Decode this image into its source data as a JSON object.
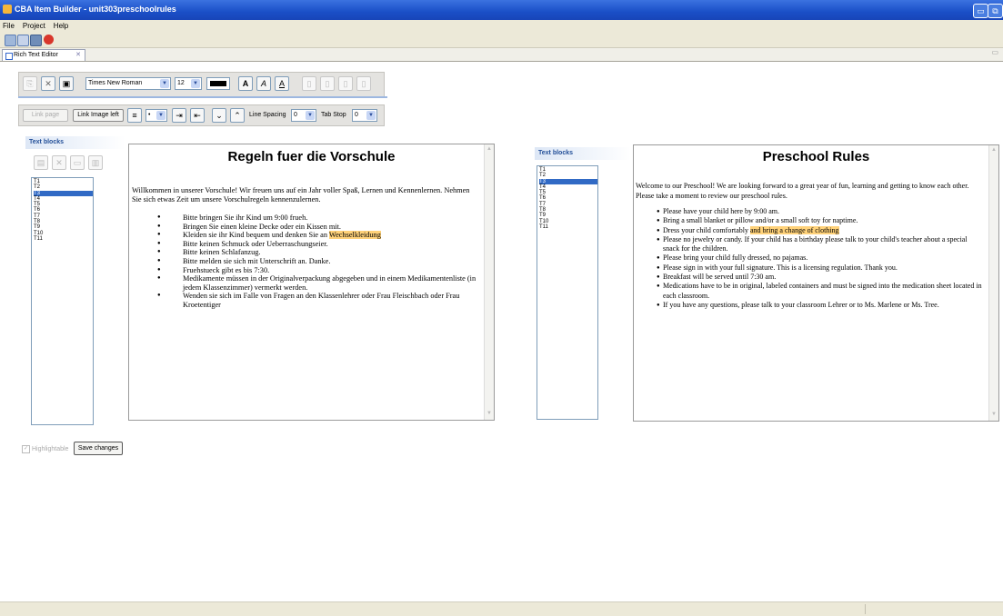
{
  "window": {
    "title": "CBA Item Builder - unit303preschoolrules"
  },
  "menu": {
    "items": [
      "File",
      "Project",
      "Help"
    ]
  },
  "tab": {
    "label": "Rich Text Editor"
  },
  "editor_toolbar": {
    "font_family": "Times New Roman",
    "font_size": "12",
    "link_page_label": "Link page",
    "link_image_left_label": "Link Image left",
    "line_spacing_label": "Line Spacing",
    "line_spacing_value": "0",
    "tab_stop_label": "Tab Stop",
    "tab_stop_value": "0",
    "text_color": "#000000"
  },
  "left_panel": {
    "header": "Text blocks",
    "blocks": [
      "T1",
      "T2",
      "T3",
      "T4",
      "T5",
      "T6",
      "T7",
      "T8",
      "T9",
      "T10",
      "T11"
    ],
    "selected_index": 2
  },
  "right_panel": {
    "header": "Text blocks",
    "blocks": [
      "T1",
      "T2",
      "T3",
      "T4",
      "T5",
      "T6",
      "T7",
      "T8",
      "T9",
      "T10",
      "T11"
    ],
    "selected_index": 2
  },
  "german_doc": {
    "title": "Regeln fuer die Vorschule",
    "intro": "Willkommen in unserer Vorschule! Wir freuen uns auf ein Jahr voller Spaß, Lernen und Kennenlernen. Nehmen Sie sich etwas Zeit um unsere Vorschulregeln kennenzulernen.",
    "rules": [
      "Bitte bringen Sie ihr Kind um 9:00 frueh.",
      "Bringen Sie einen kleine Decke oder ein Kissen mit.",
      "Kleiden sie ihr Kind bequem und denken Sie an ",
      "Bitte keinen Schmuck oder Ueberraschungseier.",
      "Bitte keinen Schlafanzug.",
      "Bitte melden sie sich mit Unterschrift an. Danke.",
      "Fruehstueck gibt es bis 7:30.",
      "Medikamente müssen in der Originalverpackung abgegeben und in einem Medikamentenliste (in jedem Klassenzimmer) vermerkt werden.",
      "Wenden sie sich im Falle von Fragen an den Klassenlehrer oder Frau Fleischbach oder Frau Kroetentiger"
    ],
    "highlight": "Wechselkleidung"
  },
  "english_doc": {
    "title": "Preschool Rules",
    "intro": "Welcome to our Preschool! We are looking forward to a great year of fun, learning and getting to know each other. Please take a moment to review our preschool rules.",
    "rules": [
      "Please have your child here by 9:00 am.",
      "Bring a small blanket or pillow and/or a small soft toy for naptime.",
      "Dress your child comfortably ",
      "Please no jewelry or candy. If your child has a birthday please talk to  your child's teacher about a special snack for the children.",
      "Please bring your child fully dressed, no pajamas.",
      "Please sign in with your full signature. This is a licensing regulation. Thank you.",
      "Breakfast will be served until 7:30 am.",
      "Medications have to be in original, labeled containers and must be signed into the medication sheet located in each classroom.",
      "If you have any questions, please talk to your classroom Lehrer or to  Ms. Marlene or Ms. Tree."
    ],
    "highlight": "and bring a change of clothing"
  },
  "bottom": {
    "highlightable_label": "Highlightable",
    "save_label": "Save changes"
  },
  "colors": {
    "titlebar": "#1a4fc7",
    "selection": "#316ac5",
    "highlight": "#ffd27a",
    "chrome": "#ece9d8"
  }
}
